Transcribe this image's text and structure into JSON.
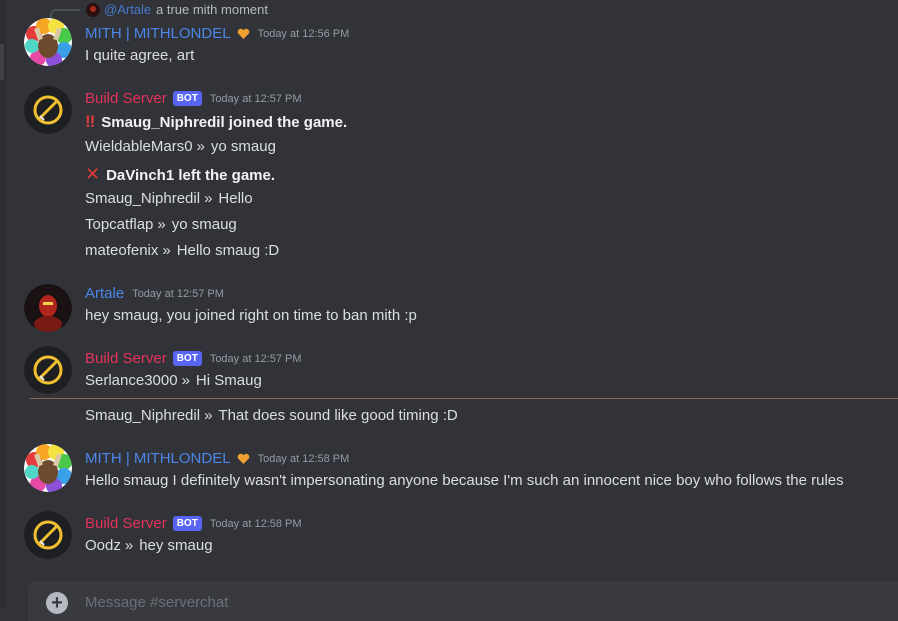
{
  "reply": {
    "author": "@Artale",
    "text": "a true mith moment"
  },
  "messages": [
    {
      "author": "MITH | MITHLONDEL",
      "timestamp": "Today at 12:56 PM",
      "lines": [
        "I quite agree, art"
      ]
    },
    {
      "author": "Build Server",
      "badge": "BOT",
      "timestamp": "Today at 12:57 PM",
      "lines": [
        {
          "icon": "double-exclamation-icon",
          "text": "Smaug_Niphredil joined the game."
        },
        {
          "user": "WieldableMars0",
          "text": "yo smaug"
        },
        {
          "icon": "red-x-icon",
          "text": "DaVinch1 left the game."
        },
        {
          "user": "Smaug_Niphredil",
          "text": "Hello"
        },
        {
          "user": "Topcatflap",
          "text": "yo smaug"
        },
        {
          "user": "mateofenix",
          "text": "Hello smaug :D"
        }
      ]
    },
    {
      "author": "Artale",
      "timestamp": "Today at 12:57 PM",
      "lines": [
        "hey smaug, you joined right on time to ban mith :p"
      ]
    },
    {
      "author": "Build Server",
      "badge": "BOT",
      "timestamp": "Today at 12:57 PM",
      "lines": [
        {
          "user": "Serlance3000",
          "text": "Hi Smaug"
        },
        {
          "user": "Smaug_Niphredil",
          "text": "That does sound like good timing :D"
        }
      ]
    },
    {
      "author": "MITH | MITHLONDEL",
      "timestamp": "Today at 12:58 PM",
      "lines": [
        "Hello smaug I definitely wasn't impersonating anyone because I'm such an innocent nice boy who follows the rules"
      ]
    },
    {
      "author": "Build Server",
      "badge": "BOT",
      "timestamp": "Today at 12:58 PM",
      "lines": [
        {
          "user": "Oodz",
          "text": "hey smaug"
        }
      ]
    }
  ],
  "separator": "»",
  "composer": {
    "placeholder": "Message #serverchat"
  },
  "colors": {
    "background": "#313338",
    "mith_name": "#4a87e8",
    "bot_name": "#e6325a",
    "bot_badge": "#5865f2",
    "new_messages_divider": "#8a6a56"
  }
}
